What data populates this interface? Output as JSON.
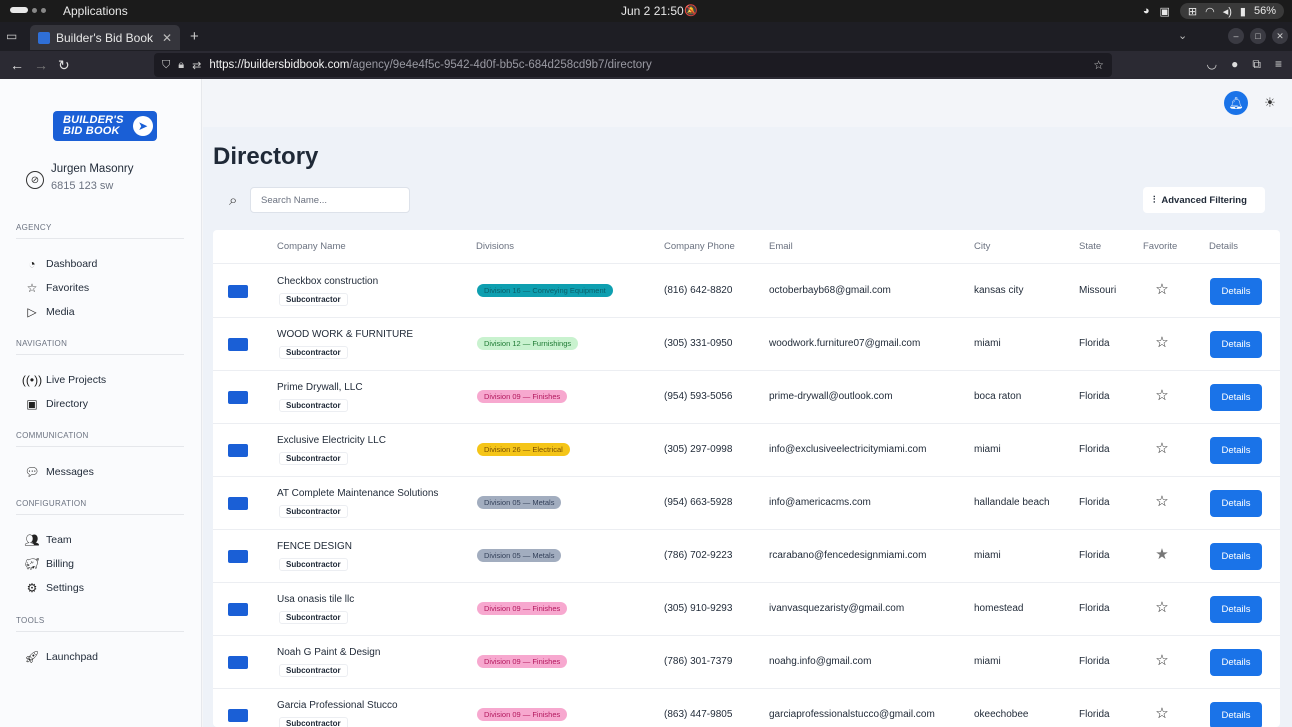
{
  "os": {
    "activities": "Applications",
    "clock": "Jun 2  21:50",
    "battery": "56%"
  },
  "browser": {
    "tab_title": "Builder's Bid Book",
    "url_host": "https://buildersbidbook.com",
    "url_path": "/agency/9e4e4f5c-9542-4d0f-bb5c-684d258cd9b7/directory"
  },
  "sidebar": {
    "logo_text_1": "BUILDER'S",
    "logo_text_2": "BID BOOK",
    "user_name": "Jurgen Masonry",
    "user_address": "6815 123 sw",
    "sections": [
      {
        "label": "AGENCY",
        "items": [
          {
            "label": "Dashboard",
            "icon": "pie-chart-icon"
          },
          {
            "label": "Favorites",
            "icon": "star-icon"
          },
          {
            "label": "Media",
            "icon": "play-icon"
          }
        ]
      },
      {
        "label": "NAVIGATION",
        "items": [
          {
            "label": "Live Projects",
            "icon": "broadcast-icon"
          },
          {
            "label": "Directory",
            "icon": "contact-book-icon"
          }
        ]
      },
      {
        "label": "COMMUNICATION",
        "items": [
          {
            "label": "Messages",
            "icon": "chat-icon"
          }
        ]
      },
      {
        "label": "CONFIGURATION",
        "items": [
          {
            "label": "Team",
            "icon": "users-icon"
          },
          {
            "label": "Billing",
            "icon": "piggy-bank-icon"
          },
          {
            "label": "Settings",
            "icon": "gear-icon"
          }
        ]
      },
      {
        "label": "TOOLS",
        "items": [
          {
            "label": "Launchpad",
            "icon": "rocket-icon"
          }
        ]
      }
    ]
  },
  "main": {
    "title": "Directory",
    "search_placeholder": "Search Name...",
    "advanced_filter_label": "Advanced Filtering",
    "columns": [
      "Company Name",
      "Divisions",
      "Company Phone",
      "Email",
      "City",
      "State",
      "Favorite",
      "Details"
    ],
    "details_label": "Details",
    "rows": [
      {
        "name": "Checkbox construction",
        "type": "Subcontractor",
        "division": "Division 16 — Conveying Equipment",
        "div_bg": "#0e9fb0",
        "div_fg": "#0b5f6a",
        "phone": "(816) 642-8820",
        "email": "octoberbayb68@gmail.com",
        "city": "kansas city",
        "state": "Missouri",
        "favorite": false
      },
      {
        "name": "WOOD WORK & FURNITURE",
        "type": "Subcontractor",
        "division": "Division 12 — Furnishings",
        "div_bg": "#c9f2cf",
        "div_fg": "#1e7a33",
        "phone": "(305) 331-0950",
        "email": "woodwork.furniture07@gmail.com",
        "city": "miami",
        "state": "Florida",
        "favorite": false
      },
      {
        "name": "Prime Drywall, LLC",
        "type": "Subcontractor",
        "division": "Division 09 — Finishes",
        "div_bg": "#f7a8cf",
        "div_fg": "#b3185e",
        "phone": "(954) 593-5056",
        "email": "prime-drywall@outlook.com",
        "city": "boca raton",
        "state": "Florida",
        "favorite": false
      },
      {
        "name": "Exclusive Electricity LLC",
        "type": "Subcontractor",
        "division": "Division 26 — Electrical",
        "div_bg": "#f5c518",
        "div_fg": "#7a4f00",
        "phone": "(305) 297-0998",
        "email": "info@exclusiveelectricitymiami.com",
        "city": "miami",
        "state": "Florida",
        "favorite": false
      },
      {
        "name": "AT Complete Maintenance Solutions",
        "type": "Subcontractor",
        "division": "Division 05 — Metals",
        "div_bg": "#a2adbf",
        "div_fg": "#34415a",
        "phone": "(954) 663-5928",
        "email": "info@americacms.com",
        "city": "hallandale beach",
        "state": "Florida",
        "favorite": false
      },
      {
        "name": "FENCE DESIGN",
        "type": "Subcontractor",
        "division": "Division 05 — Metals",
        "div_bg": "#a2adbf",
        "div_fg": "#34415a",
        "phone": "(786) 702-9223",
        "email": "rcarabano@fencedesignmiami.com",
        "city": "miami",
        "state": "Florida",
        "favorite": true
      },
      {
        "name": "Usa onasis tile llc",
        "type": "Subcontractor",
        "division": "Division 09 — Finishes",
        "div_bg": "#f7a8cf",
        "div_fg": "#b3185e",
        "phone": "(305) 910-9293",
        "email": "ivanvasquezaristy@gmail.com",
        "city": "homestead",
        "state": "Florida",
        "favorite": false
      },
      {
        "name": "Noah G Paint & Design",
        "type": "Subcontractor",
        "division": "Division 09 — Finishes",
        "div_bg": "#f7a8cf",
        "div_fg": "#b3185e",
        "phone": "(786) 301-7379",
        "email": "noahg.info@gmail.com",
        "city": "miami",
        "state": "Florida",
        "favorite": false
      },
      {
        "name": "Garcia Professional Stucco",
        "type": "Subcontractor",
        "division": "Division 09 — Finishes",
        "div_bg": "#f7a8cf",
        "div_fg": "#b3185e",
        "phone": "(863) 447-9805",
        "email": "garciaprofessionalstucco@gmail.com",
        "city": "okeechobee",
        "state": "Florida",
        "favorite": false
      }
    ]
  }
}
